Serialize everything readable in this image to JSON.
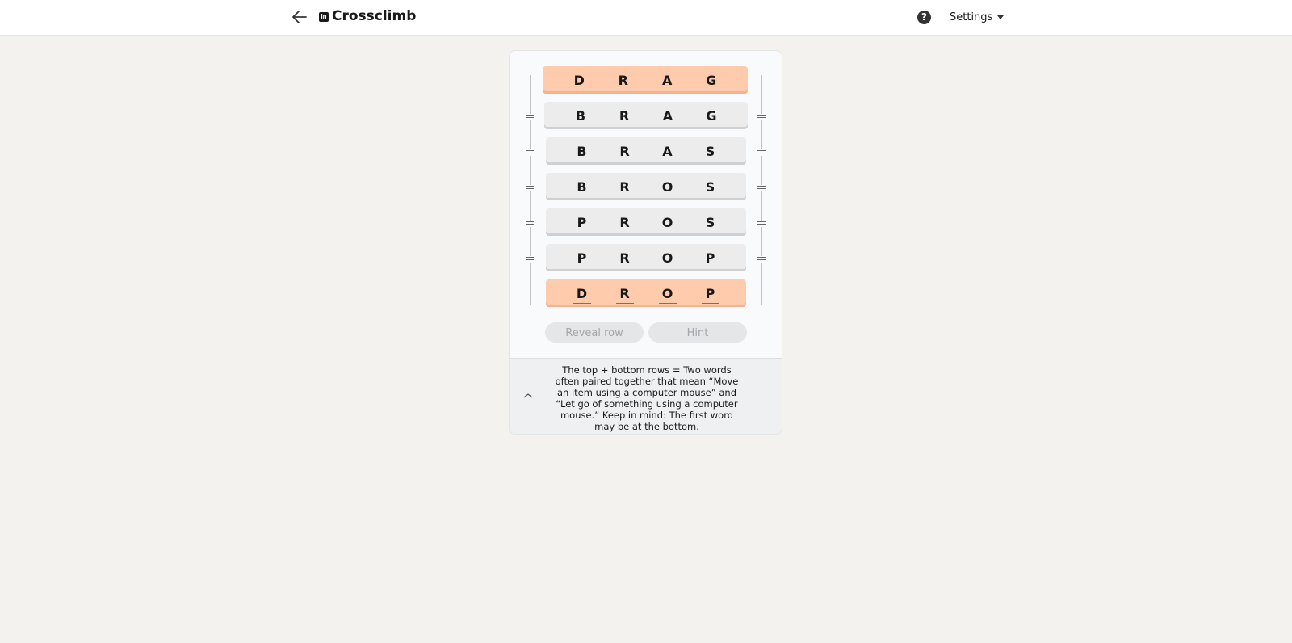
{
  "header": {
    "app_title": "Crossclimb",
    "logo_text": "in",
    "back_icon": "arrow-left-icon",
    "help_symbol": "?",
    "settings_label": "Settings"
  },
  "board": {
    "rows": [
      {
        "letters": [
          "D",
          "R",
          "A",
          "G"
        ],
        "highlight": true
      },
      {
        "letters": [
          "B",
          "R",
          "A",
          "G"
        ],
        "highlight": false
      },
      {
        "letters": [
          "B",
          "R",
          "A",
          "S"
        ],
        "highlight": false
      },
      {
        "letters": [
          "B",
          "R",
          "O",
          "S"
        ],
        "highlight": false
      },
      {
        "letters": [
          "P",
          "R",
          "O",
          "S"
        ],
        "highlight": false
      },
      {
        "letters": [
          "P",
          "R",
          "O",
          "P"
        ],
        "highlight": false
      },
      {
        "letters": [
          "D",
          "R",
          "O",
          "P"
        ],
        "highlight": true
      }
    ],
    "highlight_color": "#ffcbad"
  },
  "actions": {
    "reveal_label": "Reveal row",
    "hint_label": "Hint"
  },
  "clue": {
    "text": "The top + bottom rows = Two words often paired together that mean “Move an item using a computer mouse” and “Let go of something using a computer mouse.” Keep in mind: The first word may be at the bottom."
  }
}
